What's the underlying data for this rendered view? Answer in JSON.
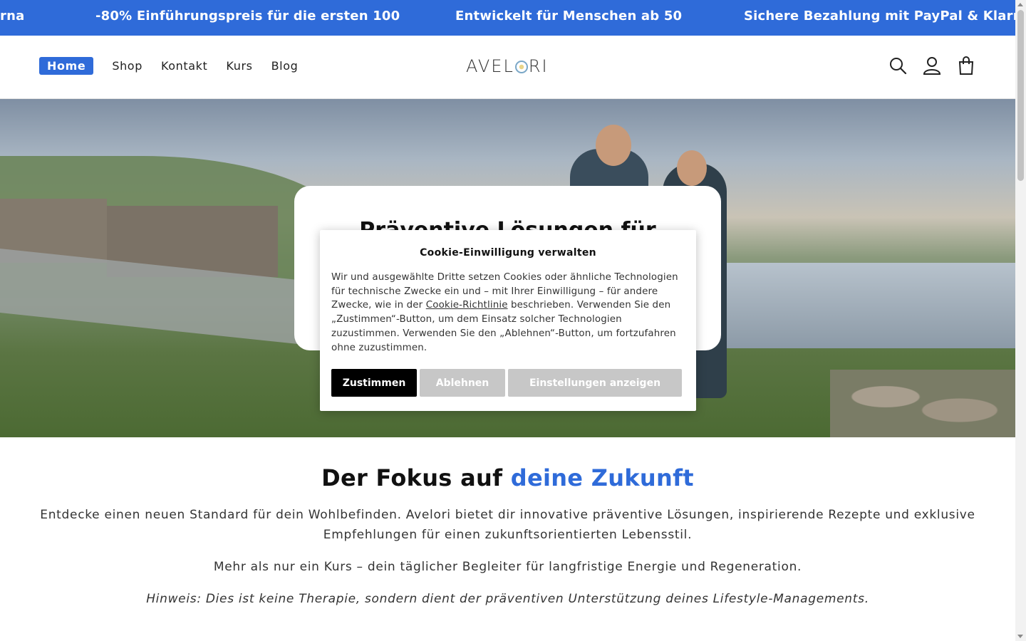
{
  "announcement": {
    "items": [
      "rna",
      "-80% Einführungspreis für die ersten 100",
      "Entwickelt für Menschen ab 50",
      "Sichere Bezahlung mit PayPal & Klarna"
    ],
    "background": "#2f6bd9"
  },
  "nav": {
    "home": "Home",
    "shop": "Shop",
    "contact": "Kontakt",
    "course": "Kurs",
    "blog": "Blog"
  },
  "logo": {
    "prefix": "AVEL",
    "suffix": "RI"
  },
  "header_icons": [
    "search-icon",
    "account-icon",
    "cart-icon"
  ],
  "hero": {
    "title": "Präventive Lösungen für"
  },
  "cookie": {
    "title": "Cookie-Einwilligung verwalten",
    "text_before_link": "Wir und ausgewählte Dritte setzen Cookies oder ähnliche Technologien für technische Zwecke ein und – mit Ihrer Einwilligung – für andere Zwecke, wie in der ",
    "link": "Cookie-Richtlinie",
    "text_after_link": " beschrieben. Verwenden Sie den „Zustimmen“-Button, um dem Einsatz solcher Technologien zuzustimmen. Verwenden Sie den „Ablehnen“-Button, um fortzufahren ohne zuzustimmen.",
    "accept": "Zustimmen",
    "deny": "Ablehnen",
    "settings": "Einstellungen anzeigen"
  },
  "content": {
    "heading_part1": "Der Fokus auf ",
    "heading_part2": "deine Zukunft",
    "paragraph1": "Entdecke einen neuen Standard für dein Wohlbefinden. Avelori bietet dir innovative präventive Lösungen, inspirierende Rezepte und exklusive Empfehlungen für einen zukunftsorientierten Lebensstil.",
    "paragraph2": "Mehr als nur ein Kurs – dein täglicher Begleiter für langfristige Energie und Regeneration.",
    "note_label": "Hinweis",
    "note_text": ": Dies ist keine Therapie, sondern dient der präventiven Unterstützung deines Lifestyle-Managements."
  },
  "colors": {
    "accent": "#2f6bd9",
    "accept_button": "#000000",
    "secondary_button": "#c7c7c7"
  }
}
